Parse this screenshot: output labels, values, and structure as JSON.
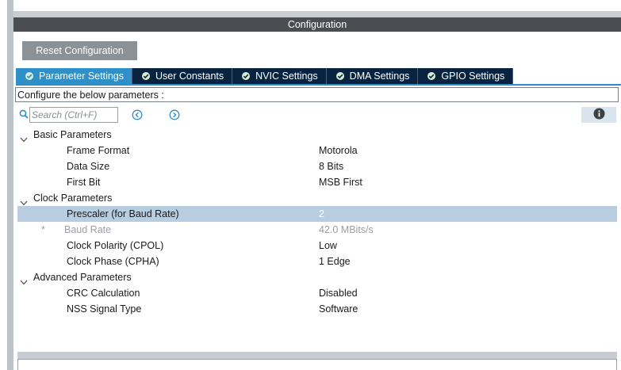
{
  "window": {
    "title": "Configuration"
  },
  "toolbar": {
    "reset_label": "Reset Configuration"
  },
  "tabs": [
    {
      "label": "Parameter Settings",
      "active": true
    },
    {
      "label": "User Constants",
      "active": false
    },
    {
      "label": "NVIC Settings",
      "active": false
    },
    {
      "label": "DMA Settings",
      "active": false
    },
    {
      "label": "GPIO Settings",
      "active": false
    }
  ],
  "info_text": "Configure the below parameters :",
  "search": {
    "placeholder": "Search (Ctrl+F)",
    "value": ""
  },
  "tree": {
    "basic": {
      "label": "Basic Parameters",
      "frame_format": {
        "name": "Frame Format",
        "value": "Motorola"
      },
      "data_size": {
        "name": "Data Size",
        "value": "8 Bits"
      },
      "first_bit": {
        "name": "First Bit",
        "value": "MSB First"
      }
    },
    "clock": {
      "label": "Clock Parameters",
      "prescaler": {
        "name": "Prescaler (for Baud Rate)",
        "value": "2"
      },
      "baud_rate": {
        "marker": "*",
        "name": "Baud Rate",
        "value": "42.0 MBits/s"
      },
      "cpol": {
        "name": "Clock Polarity (CPOL)",
        "value": "Low"
      },
      "cpha": {
        "name": "Clock Phase (CPHA)",
        "value": "1 Edge"
      }
    },
    "advanced": {
      "label": "Advanced Parameters",
      "crc": {
        "name": "CRC Calculation",
        "value": "Disabled"
      },
      "nss": {
        "name": "NSS Signal Type",
        "value": "Software"
      }
    }
  },
  "colors": {
    "title_bar": "#4a4e53",
    "tab_active": "#2f8fc9",
    "tab_inactive": "#07233f",
    "selected_row": "#b8cde0",
    "reset_button": "#8c9196"
  },
  "icons": {
    "tab_status": "check-circle-icon",
    "search": "search-icon",
    "prev": "chevron-left-circle-icon",
    "next": "chevron-right-circle-icon",
    "info": "info-icon",
    "expand": "chevron-down-icon"
  }
}
